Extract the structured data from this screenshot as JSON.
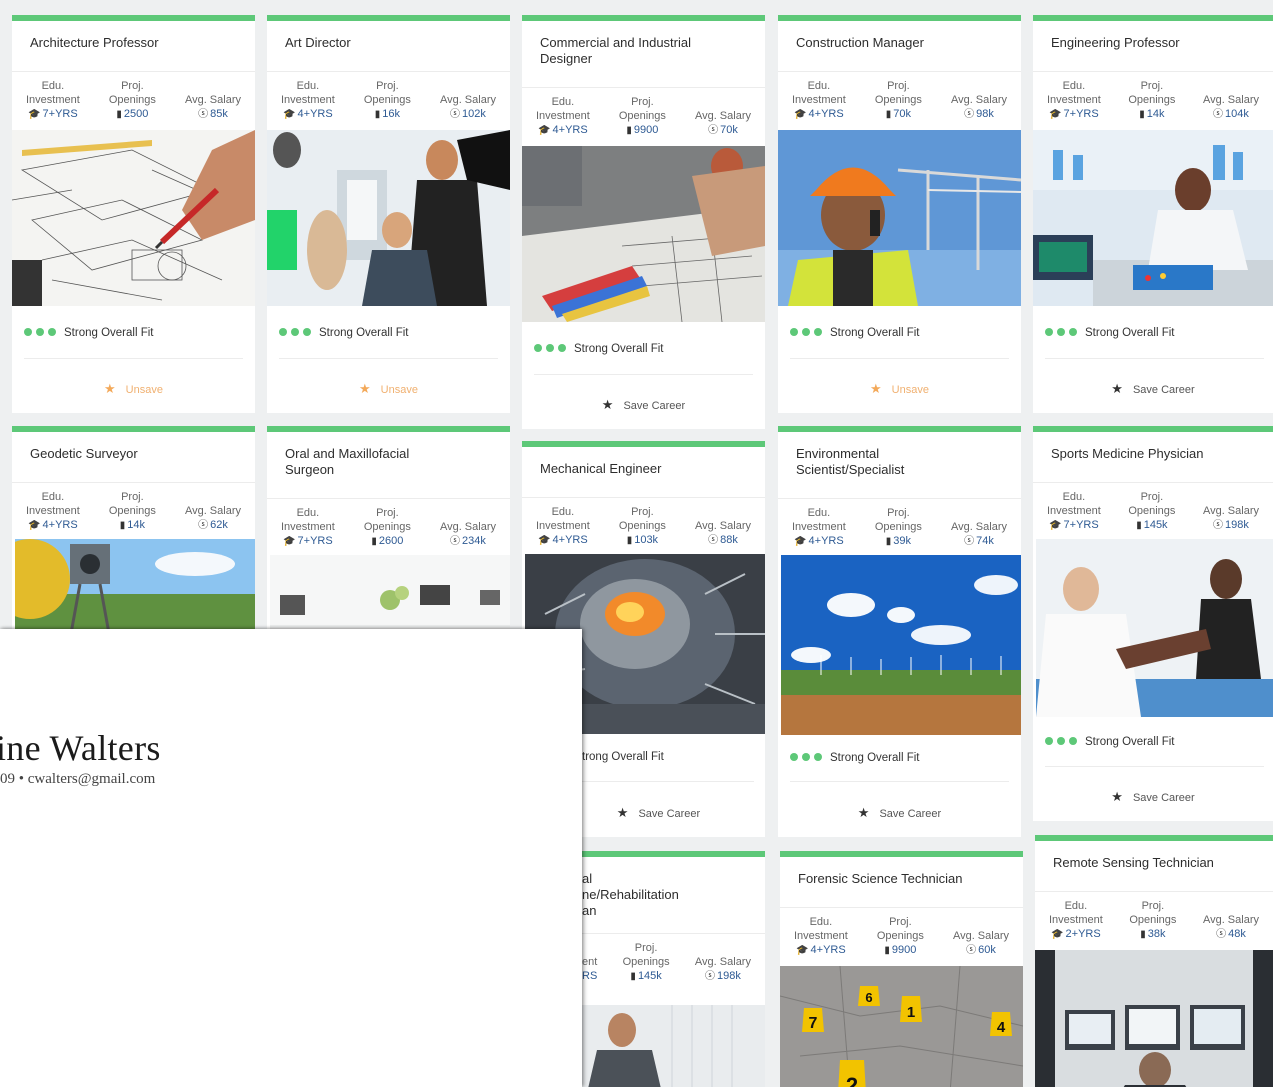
{
  "labels": {
    "edu_line1": "Edu.",
    "edu_line2": "Investment",
    "proj_line1": "Proj.",
    "proj_line2": "Openings",
    "salary": "Avg. Salary",
    "fit": "Strong Overall Fit",
    "unsave": "Unsave",
    "save": "Save Career"
  },
  "cards": [
    {
      "title": "Architecture Professor",
      "edu": "7+YRS",
      "openings": "2500",
      "salary": "85k",
      "saved": true
    },
    {
      "title": "Art Director",
      "edu": "4+YRS",
      "openings": "16k",
      "salary": "102k",
      "saved": true
    },
    {
      "title": "Commercial and Industrial Designer",
      "edu": "4+YRS",
      "openings": "9900",
      "salary": "70k",
      "saved": false
    },
    {
      "title": "Construction Manager",
      "edu": "4+YRS",
      "openings": "70k",
      "salary": "98k",
      "saved": true
    },
    {
      "title": "Engineering Professor",
      "edu": "7+YRS",
      "openings": "14k",
      "salary": "104k",
      "saved": false
    },
    {
      "title": "Geodetic Surveyor",
      "edu": "4+YRS",
      "openings": "14k",
      "salary": "62k"
    },
    {
      "title": "Oral and Maxillofacial Surgeon",
      "edu": "7+YRS",
      "openings": "2600",
      "salary": "234k"
    },
    {
      "title": "Mechanical Engineer",
      "edu": "4+YRS",
      "openings": "103k",
      "salary": "88k",
      "fit": "trong Overall Fit",
      "saved": false
    },
    {
      "title": "Environmental Scientist/Specialist",
      "edu": "4+YRS",
      "openings": "39k",
      "salary": "74k",
      "saved": false
    },
    {
      "title": "Sports Medicine Physician",
      "edu": "7+YRS",
      "openings": "145k",
      "salary": "198k",
      "saved": false
    },
    {
      "title_line1": "al",
      "title_line2": "ne/Rehabilitation",
      "title_line3": "an",
      "edu_line2": "ent",
      "edu": "RS",
      "openings": "145k",
      "salary": "198k"
    },
    {
      "title": "Forensic Science Technician",
      "edu": "4+YRS",
      "openings": "9900",
      "salary": "60k"
    },
    {
      "title": "Remote Sensing Technician",
      "edu": "2+YRS",
      "openings": "38k",
      "salary": "48k"
    }
  ],
  "resume": {
    "name": "ine Walters",
    "contact": "09 • cwalters@gmail.com"
  },
  "forensic_markers": [
    "6",
    "7",
    "1",
    "4",
    "2"
  ]
}
